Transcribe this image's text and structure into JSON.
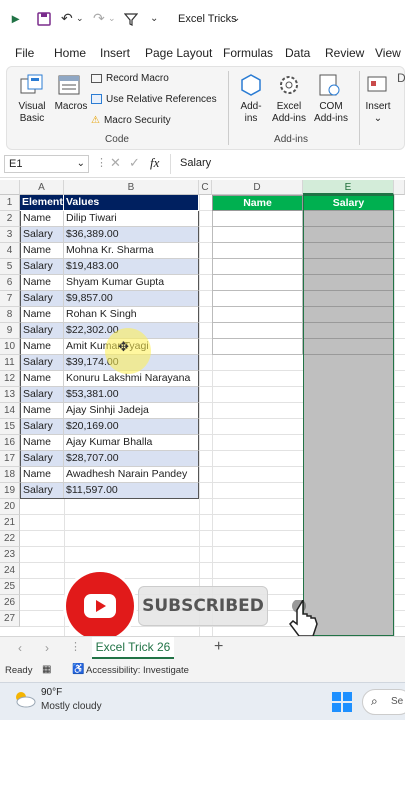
{
  "window": {
    "title": "Excel Tricks"
  },
  "menu": [
    "File",
    "Home",
    "Insert",
    "Page Layout",
    "Formulas",
    "Data",
    "Review",
    "View"
  ],
  "ribbon": {
    "code": {
      "visual_basic": "Visual Basic",
      "macros": "Macros",
      "record_macro": "Record Macro",
      "use_relative": "Use Relative References",
      "macro_security": "Macro Security",
      "group": "Code"
    },
    "addins": {
      "addins": "Add-ins",
      "excel_addins": "Excel Add-ins",
      "com_addins": "COM Add-ins",
      "group": "Add-ins"
    },
    "insert": "Insert"
  },
  "formula_bar": {
    "name_box": "E1",
    "fx": "fx",
    "content": "Salary"
  },
  "columns": [
    "A",
    "B",
    "C",
    "D",
    "E"
  ],
  "rows": [
    "1",
    "2",
    "3",
    "4",
    "5",
    "6",
    "7",
    "8",
    "9",
    "10",
    "11",
    "12",
    "13",
    "14",
    "15",
    "16",
    "17",
    "18",
    "19",
    "20",
    "21",
    "22",
    "23",
    "24",
    "25",
    "26",
    "27"
  ],
  "table": {
    "header": [
      "Element",
      "Values"
    ],
    "rows": [
      [
        "Name",
        "Dilip Tiwari"
      ],
      [
        "Salary",
        "$36,389.00"
      ],
      [
        "Name",
        "Mohna Kr. Sharma"
      ],
      [
        "Salary",
        "$19,483.00"
      ],
      [
        "Name",
        "Shyam Kumar Gupta"
      ],
      [
        "Salary",
        "$9,857.00"
      ],
      [
        "Name",
        "Rohan K Singh"
      ],
      [
        "Salary",
        "$22,302.00"
      ],
      [
        "Name",
        "Amit Kumar Tyagi"
      ],
      [
        "Salary",
        "$39,174.00"
      ],
      [
        "Name",
        "Konuru Lakshmi Narayana"
      ],
      [
        "Salary",
        "$53,381.00"
      ],
      [
        "Name",
        "Ajay Sinhji Jadeja"
      ],
      [
        "Salary",
        "$20,169.00"
      ],
      [
        "Name",
        "Ajay Kumar Bhalla"
      ],
      [
        "Salary",
        "$28,707.00"
      ],
      [
        "Name",
        "Awadhesh Narain Pandey"
      ],
      [
        "Salary",
        "$11,597.00"
      ]
    ]
  },
  "output": {
    "name_header": "Name",
    "salary_header": "Salary"
  },
  "subscribe": {
    "label": "SUBSCRIBED"
  },
  "sheet_tabs": {
    "active": "Excel Trick 26",
    "add": "+"
  },
  "status": {
    "ready": "Ready",
    "accessibility": "Accessibility: Investigate"
  },
  "taskbar": {
    "temp": "90°F",
    "weather": "Mostly cloudy",
    "search": "Se"
  },
  "colors": {
    "header_fill": "#002060",
    "green_header": "#00b050",
    "stripe": "#d9e1f2",
    "gray_col": "#bfbfbf"
  }
}
